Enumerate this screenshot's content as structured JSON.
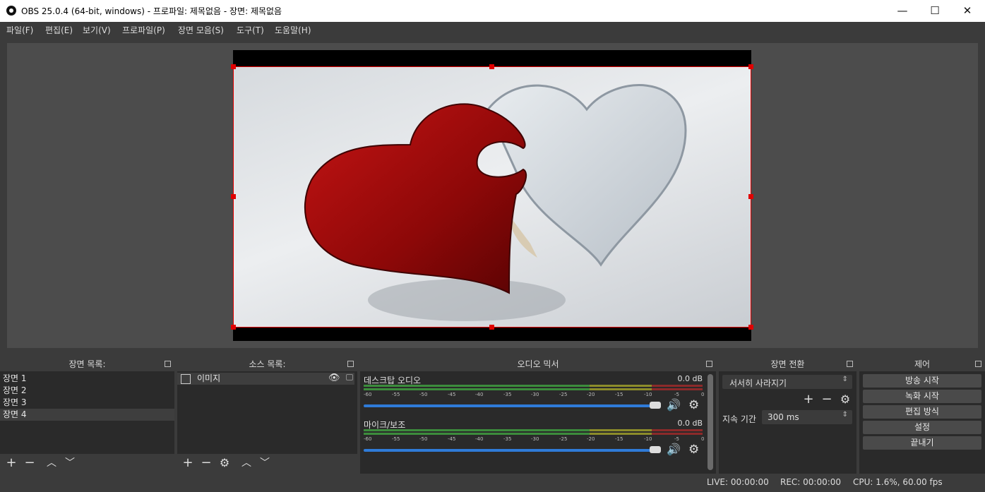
{
  "window": {
    "title": "OBS 25.0.4 (64-bit, windows) - 프로파일: 제목없음 - 장면: 제목없음",
    "min": "—",
    "max": "☐",
    "close": "✕"
  },
  "menu": [
    "파일(F)",
    "편집(E)",
    "보기(V)",
    "프로파일(P)",
    "장면 모음(S)",
    "도구(T)",
    "도움말(H)"
  ],
  "scenes": {
    "title": "장면 목록:",
    "items": [
      "장면 1",
      "장면 2",
      "장면 3",
      "장면 4"
    ],
    "selected_index": 3
  },
  "sources": {
    "title": "소스 목록:",
    "items": [
      {
        "name": "이미지",
        "visible": true,
        "locked": false
      }
    ]
  },
  "mixer": {
    "title": "오디오 믹서",
    "ticks": [
      "-60",
      "-55",
      "-50",
      "-45",
      "-40",
      "-35",
      "-30",
      "-25",
      "-20",
      "-15",
      "-10",
      "-5",
      "0"
    ],
    "channels": [
      {
        "name": "데스크탑 오디오",
        "db": "0.0 dB"
      },
      {
        "name": "마이크/보조",
        "db": "0.0 dB"
      }
    ]
  },
  "transitions": {
    "title": "장면 전환",
    "selected": "서서히 사라지기",
    "duration_label": "지속 기간",
    "duration_value": "300 ms"
  },
  "controls": {
    "title": "제어",
    "buttons": [
      "방송 시작",
      "녹화 시작",
      "편집 방식",
      "설정",
      "끝내기"
    ]
  },
  "status": {
    "live": "LIVE: 00:00:00",
    "rec": "REC: 00:00:00",
    "cpu": "CPU: 1.6%, 60.00 fps"
  },
  "colors": {
    "accent": "#2f7bd8",
    "selection": "#e00000",
    "meter_green": "#3c8c3c",
    "meter_yellow": "#8c8c2a",
    "meter_red": "#8c2a2a"
  }
}
